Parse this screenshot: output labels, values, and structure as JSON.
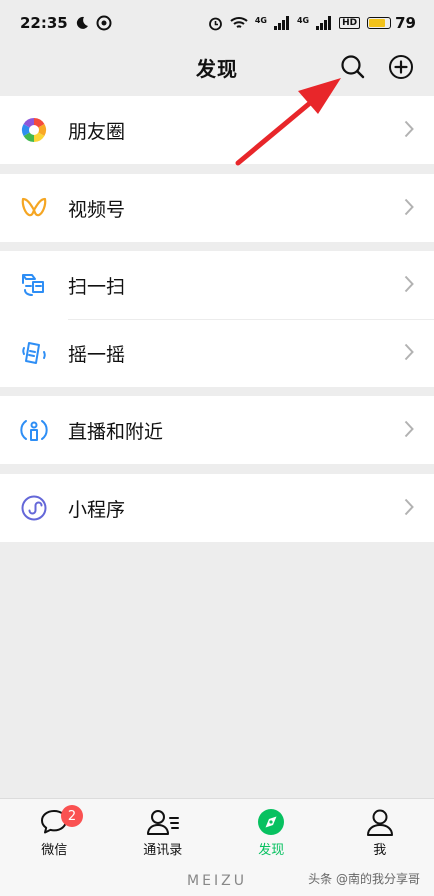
{
  "status": {
    "time": "22:35",
    "network_a": "4G",
    "network_b": "4G",
    "hd": "HD",
    "battery": "79",
    "battery_level": 0.79
  },
  "nav": {
    "title": "发现"
  },
  "menu": {
    "moments": "朋友圈",
    "channels": "视频号",
    "scan": "扫一扫",
    "shake": "摇一摇",
    "live_nearby": "直播和附近",
    "mini_programs": "小程序"
  },
  "tabs": {
    "chats": "微信",
    "contacts": "通讯录",
    "discover": "发现",
    "me": "我",
    "chats_badge": "2"
  },
  "footer": {
    "brand": "MEIZU",
    "watermark": "头条 @南的我分享哥"
  },
  "colors": {
    "accent": "#07c160",
    "badge": "#fa5151",
    "arrow": "#e8262a"
  }
}
